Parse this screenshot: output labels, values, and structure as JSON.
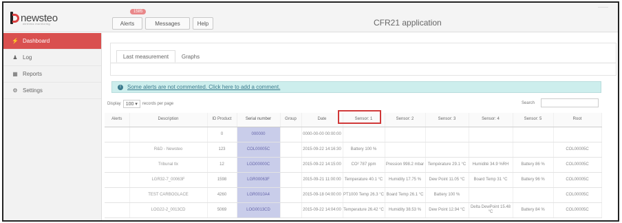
{
  "brand": {
    "name": "newsteo",
    "tagline": "wireless monitoring"
  },
  "topbar": {
    "alerts_label": "Alerts",
    "alerts_badge": "1585",
    "messages_label": "Messages",
    "help_label": "Help",
    "app_title": "CFR21 application",
    "corner_text": "———"
  },
  "sidebar": {
    "items": [
      {
        "label": "Dashboard",
        "icon": "dashboard-icon",
        "glyph": "⚡",
        "active": true
      },
      {
        "label": "Log",
        "icon": "user-icon",
        "glyph": "♟",
        "active": false
      },
      {
        "label": "Reports",
        "icon": "reports-icon",
        "glyph": "▦",
        "active": false
      },
      {
        "label": "Settings",
        "icon": "settings-icon",
        "glyph": "⚙",
        "active": false
      }
    ]
  },
  "tabs": [
    {
      "label": "Last measurement",
      "active": true
    },
    {
      "label": "Graphs",
      "active": false
    }
  ],
  "alert_banner": {
    "icon_glyph": "!",
    "text": "Some alerts are not commented. Click here to add a comment."
  },
  "table_controls": {
    "display_label": "Display",
    "page_size": "100",
    "page_size_arrow": "▾",
    "records_label": "records per page",
    "search_label": "Search"
  },
  "table": {
    "columns": [
      "Alerts",
      "Description",
      "ID Product",
      "Serial number",
      "Group",
      "Date",
      "Sensor: 1",
      "Sensor: 2",
      "Sensor: 3",
      "Sensor: 4",
      "Sensor: 5",
      "Root"
    ],
    "rows": [
      [
        "",
        "",
        "0",
        "000000",
        "",
        "0000-00-00 00:00:00",
        "",
        "",
        "",
        "",
        "",
        ""
      ],
      [
        "",
        "R&D - Newsteo",
        "123",
        "COL00005C",
        "",
        "2015-09-22 14:16:30",
        "Battery 100 %",
        "",
        "",
        "",
        "",
        "COL00005C"
      ],
      [
        "",
        "Tribunal tlx",
        "12",
        "LGD00000C",
        "",
        "2015-09-22 14:15:00",
        "CO² 787 ppm",
        "Pression 998.2 mbar",
        "Température 29.1 °C",
        "Humidité 34.9 %RH",
        "Battery 86 %",
        "COL00005C"
      ],
      [
        "",
        "LGR32-7_00063F",
        "1598",
        "LGR00063F",
        "",
        "2015-09-21 11:00:00",
        "Temperature 40.1 °C",
        "Humidity 17.75 %",
        "Dew Point 11.05 °C",
        "Board Temp 31 °C",
        "Battery 96 %",
        "COL00005C"
      ],
      [
        "",
        "TEST CARBOGLACE",
        "4260",
        "LGR0010A4",
        "",
        "2015-09-18 04:00:00",
        "PT1000 Temp 26.3 °C",
        "Board Temp 26.1 °C",
        "Battery 100 %",
        "",
        "",
        "COL00005C"
      ],
      [
        "",
        "LOG22-2_0013CD",
        "5069",
        "LOG0013CD",
        "",
        "2015-09-22 14:04:00",
        "Temperature 26.42 °C",
        "Humidity 38.53 %",
        "Dew Point 12.94 °C",
        "Delta DewPoint 15.48 °C",
        "Battery 84 %",
        "COL00005C"
      ]
    ]
  }
}
